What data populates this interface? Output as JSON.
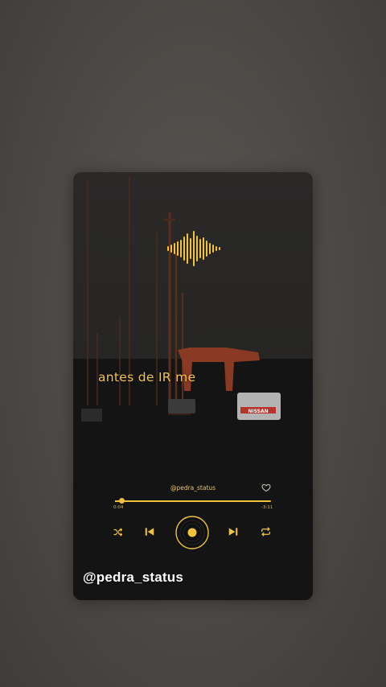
{
  "player": {
    "lyric_line": "antes de IR me",
    "track_user": "@pedra_status",
    "time_elapsed": "0:04",
    "time_remaining": "-3:11",
    "progress_fraction": 0.04,
    "liked": false,
    "watermark": "@pedra_status",
    "car_plate_text": "NISSAN"
  },
  "icons": {
    "waveform": "soundwave-icon",
    "heart": "heart-icon",
    "shuffle": "shuffle-icon",
    "previous": "skip-previous-icon",
    "play": "vinyl-disc-play-icon",
    "next": "skip-next-icon",
    "repeat": "repeat-icon"
  },
  "colors": {
    "accent": "#f0c23e",
    "lyric": "#f2c44a",
    "watermark": "#ffffff",
    "background": "#4c4845"
  }
}
